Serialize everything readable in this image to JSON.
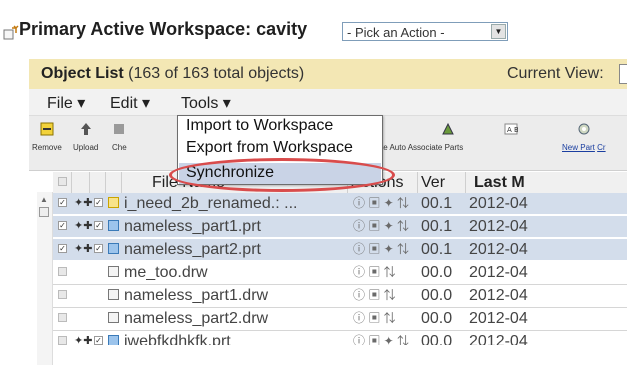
{
  "header": {
    "title": "Primary Active Workspace: cavity",
    "action_select": "- Pick an Action -"
  },
  "object_list": {
    "title": "Object List",
    "count": "(163 of 163 total objects)",
    "current_view_label": "Current View:"
  },
  "menubar": {
    "file": "File ▾",
    "edit": "Edit ▾",
    "tools": "Tools ▾"
  },
  "toolbar": {
    "remove": "Remove",
    "upload": "Upload",
    "check": "Che",
    "auto_associate": "te  Auto Associate Parts",
    "new_part": "New Part",
    "cr": "Cr"
  },
  "tools_menu": {
    "items": [
      "Import to Workspace",
      "Export from Workspace",
      "Synchronize"
    ]
  },
  "grid": {
    "headers": {
      "file_name": "File Name",
      "actions": "Actions",
      "version": "Ver",
      "last_modified": "Last M"
    },
    "rows": [
      {
        "name": "i_need_2b_renamed.: ...",
        "ver": "00.1",
        "date": "2012-04"
      },
      {
        "name": "nameless_part1.prt",
        "ver": "00.1",
        "date": "2012-04"
      },
      {
        "name": "nameless_part2.prt",
        "ver": "00.1",
        "date": "2012-04"
      },
      {
        "name": "me_too.drw",
        "ver": "00.0",
        "date": "2012-04"
      },
      {
        "name": "nameless_part1.drw",
        "ver": "00.0",
        "date": "2012-04"
      },
      {
        "name": "nameless_part2.drw",
        "ver": "00.0",
        "date": "2012-04"
      },
      {
        "name": "iwebfkdhkfk.prt",
        "ver": "00.0",
        "date": "2012-04"
      }
    ]
  },
  "colors": {
    "object_bar": "#f3e7b4",
    "selected_row": "#d3ddeb",
    "highlight_ring": "#d94c4c"
  }
}
